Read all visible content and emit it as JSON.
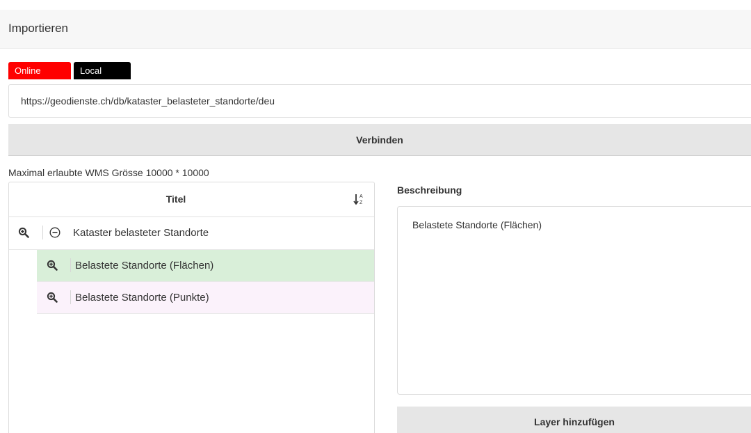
{
  "header": {
    "title": "Importieren"
  },
  "tabs": [
    {
      "label": "Online",
      "color": "#ff0000",
      "active": true
    },
    {
      "label": "Local",
      "color": "#000000",
      "active": false
    }
  ],
  "url_input": {
    "value": "https://geodienste.ch/db/kataster_belasteter_standorte/deu"
  },
  "connect_button": {
    "label": "Verbinden"
  },
  "max_size_text": "Maximal erlaubte WMS Grösse 10000 * 10000",
  "tree": {
    "column_title": "Titel",
    "sort_icon": "sort-alpha-icon",
    "root": {
      "label": "Kataster belasteter Standorte",
      "zoom_icon": "zoom-in-icon",
      "collapse_icon": "minus-circle-icon"
    },
    "children": [
      {
        "label": "Belastete Standorte (Flächen)",
        "zoom_icon": "zoom-in-icon",
        "selected": true
      },
      {
        "label": "Belastete Standorte (Punkte)",
        "zoom_icon": "zoom-in-icon",
        "selected": false
      }
    ]
  },
  "description": {
    "label": "Beschreibung",
    "text": "Belastete Standorte (Flächen)"
  },
  "add_layer_button": {
    "label": "Layer hinzufügen"
  },
  "colors": {
    "selected_row": "#d9efd9",
    "hover_row": "#fbf2fb",
    "button_bg": "#e6e6e6"
  }
}
